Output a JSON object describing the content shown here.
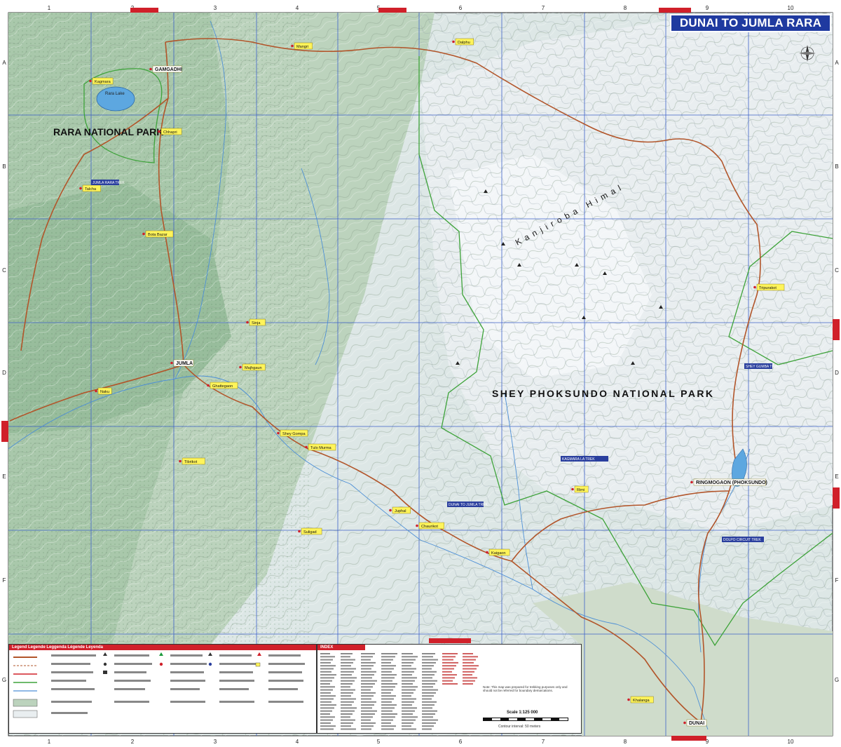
{
  "title": "DUNAI TO JUMLA RARA",
  "parks": {
    "rara": "RARA NATIONAL PARK",
    "shey": "SHEY PHOKSUNDO NATIONAL PARK"
  },
  "features": {
    "kanjiroba": "Kanjiroba Himal",
    "lake": "Rara Lake"
  },
  "towns": [
    "GAMGADHI",
    "JUMLA",
    "DUNAI",
    "RINGMOGAON (PHOKSUNDO)",
    "Chhapri",
    "Talcha",
    "Bota Bazar",
    "Tibrikot",
    "Chaurikot",
    "Kaigaon",
    "Dalphu",
    "Mangri",
    "Majhgaun",
    "Ghattegaon",
    "Sinja",
    "Tulo Murma",
    "Naku",
    "Khalanga",
    "Juphal",
    "Tripurakot",
    "Shey Gompa",
    "Suligad",
    "Rimi",
    "Kagmara"
  ],
  "legend": {
    "title": "Legend Legende Leggenda Légende Leyenda",
    "index_title": "INDEX",
    "note": "Note: This map was prepared for trekking purposes only and should not be referred for boundary demarcations.",
    "scale": "Scale 1:125 000",
    "contour": "Contour interval: 50 meters"
  },
  "grid": {
    "cols": [
      "1",
      "2",
      "3",
      "4",
      "5",
      "6",
      "7",
      "8",
      "9",
      "10"
    ],
    "rows": [
      "A",
      "B",
      "C",
      "D",
      "E",
      "F",
      "G"
    ]
  },
  "tags": {
    "jumla_rara": "JUMLA RARA TREK",
    "dunai_jumla": "DUNAI TO JUMLA TREK",
    "kagmara": "KAGMARA LA TREK",
    "shey": "SHEY GUMBA TREK",
    "dolpo": "DOLPO CIRCUIT TREK"
  }
}
